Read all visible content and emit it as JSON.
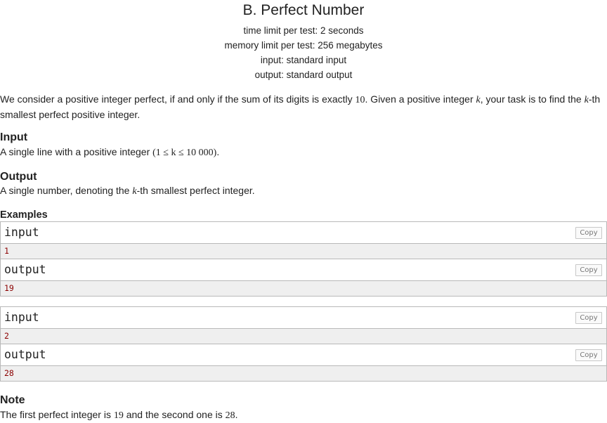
{
  "problem": {
    "title": "B. Perfect Number",
    "time_limit": "time limit per test: 2 seconds",
    "memory_limit": "memory limit per test: 256 megabytes",
    "input_file": "input: standard input",
    "output_file": "output: standard output"
  },
  "statement": {
    "part1": "We consider a positive integer perfect, if and only if the sum of its digits is exactly ",
    "num10": "10",
    "part2": ". Given a positive integer ",
    "k": "k",
    "part3": ", your task is to find the ",
    "part4": "-th",
    "part5": "smallest perfect positive integer."
  },
  "input_section": {
    "heading": "Input",
    "text_a": "A single line with a positive integer ",
    "constraint": "(1 ≤ k ≤ 10 000)",
    "text_b": "."
  },
  "output_section": {
    "heading": "Output",
    "text_a": "A single number, denoting the ",
    "text_b": "-th smallest perfect integer."
  },
  "examples": {
    "heading": "Examples",
    "copy_label": "Copy",
    "input_label": "input",
    "output_label": "output",
    "items": [
      {
        "input": "1",
        "output": "19"
      },
      {
        "input": "2",
        "output": "28"
      }
    ]
  },
  "note": {
    "heading": "Note",
    "text_a": "The first perfect integer is ",
    "first": "19",
    "text_b": " and the second one is ",
    "second": "28",
    "text_c": "."
  }
}
